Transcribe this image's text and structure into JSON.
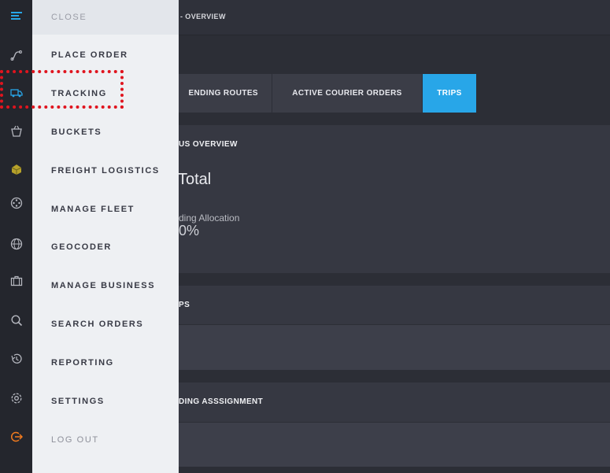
{
  "header": {
    "breadcrumb": "- OVERVIEW"
  },
  "tabs": [
    {
      "label": "ENDING ROUTES",
      "active": false
    },
    {
      "label": "ACTIVE COURIER ORDERS",
      "active": false
    },
    {
      "label": "TRIPS",
      "active": true
    }
  ],
  "status_overview": {
    "title": "US OVERVIEW",
    "total_label": "Total",
    "pending_label": "ding Allocation",
    "pending_value": "0%"
  },
  "trips_panel": {
    "title": "PS"
  },
  "pending_assignment_panel": {
    "title": "DING ASSSIGNMENT"
  },
  "menu": {
    "close": "CLOSE",
    "items": [
      "PLACE ORDER",
      "TRACKING",
      "BUCKETS",
      "FREIGHT LOGISTICS",
      "MANAGE FLEET",
      "GEOCODER",
      "MANAGE BUSINESS",
      "SEARCH ORDERS",
      "REPORTING",
      "SETTINGS"
    ],
    "logout": "LOG OUT"
  },
  "colors": {
    "accent": "#28a6e8",
    "logout_icon": "#f07a1e",
    "highlight": "#e0141e"
  },
  "rail_icons": [
    "menu-icon",
    "route-icon",
    "truck-icon",
    "basket-icon",
    "box-icon",
    "film-reel-icon",
    "globe-icon",
    "briefcase-icon",
    "search-icon",
    "history-icon",
    "gear-icon",
    "logout-icon"
  ]
}
